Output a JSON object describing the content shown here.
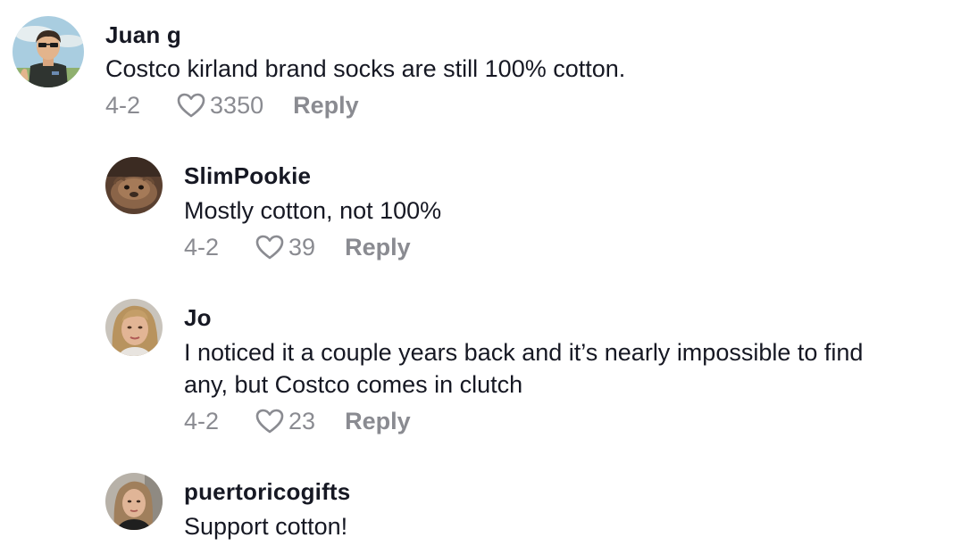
{
  "comments": [
    {
      "username": "Juan g",
      "text_lines": [
        "Costco kirland brand socks are still 100% cotton."
      ],
      "date": "4-2",
      "likes": "3350",
      "reply_label": "Reply",
      "avatar": "cartoon-man-avatar"
    },
    {
      "username": "SlimPookie",
      "text_lines": [
        "Mostly cotton, not 100%"
      ],
      "date": "4-2",
      "likes": "39",
      "reply_label": "Reply",
      "avatar": "animal-photo-avatar"
    },
    {
      "username": "Jo",
      "text_lines": [
        "I noticed it a couple years back and it’s nearly impossible to find",
        "any, but Costco comes in clutch"
      ],
      "date": "4-2",
      "likes": "23",
      "reply_label": "Reply",
      "avatar": "woman-blonde-avatar"
    },
    {
      "username": "puertoricogifts",
      "text_lines": [
        "Support cotton!"
      ],
      "date": "",
      "likes": "",
      "reply_label": "",
      "avatar": "woman-photo-avatar"
    }
  ],
  "colors": {
    "text_primary": "#161823",
    "text_secondary": "#8a8b91",
    "background": "#ffffff"
  },
  "icons": {
    "like": "heart-outline-icon"
  }
}
